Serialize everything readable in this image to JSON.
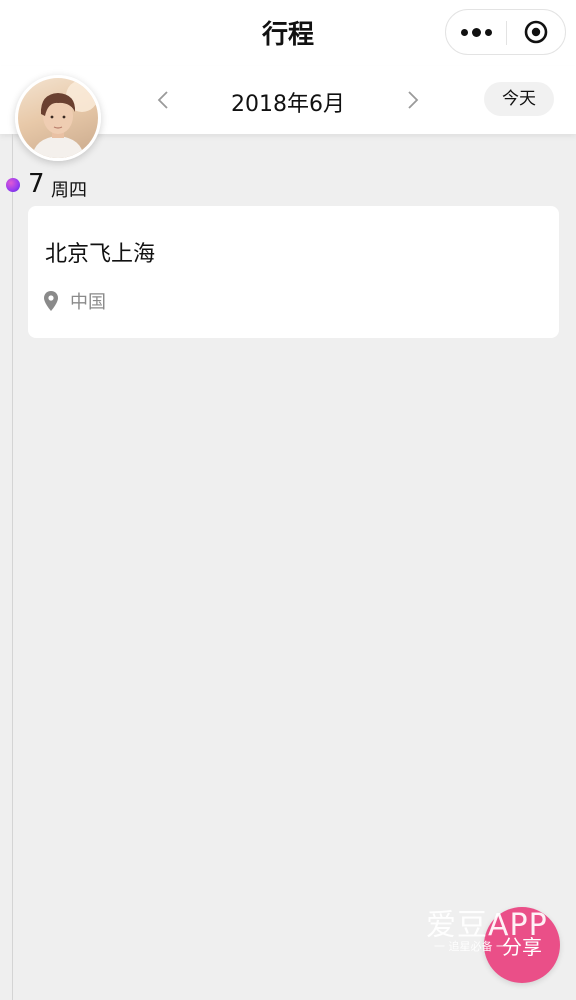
{
  "header": {
    "title": "行程",
    "more_icon": "ellipsis-icon",
    "close_icon": "target-circle-icon"
  },
  "month_nav": {
    "label": "2018年6月",
    "prev_icon": "chevron-left-icon",
    "next_icon": "chevron-right-icon",
    "today_label": "今天"
  },
  "timeline": {
    "days": [
      {
        "day": "7",
        "weekday": "周四",
        "events": [
          {
            "title": "北京飞上海",
            "location": "中国",
            "location_icon": "location-pin-icon"
          }
        ]
      }
    ]
  },
  "share": {
    "label": "分享"
  },
  "watermark": {
    "main": "爱豆APP",
    "sub": "一 追星必备 一"
  },
  "colors": {
    "background": "#efefef",
    "card": "#ffffff",
    "share_button": "#ea4f88",
    "timeline_dot": "#9a3df0",
    "muted_text": "#8a8a8a"
  }
}
